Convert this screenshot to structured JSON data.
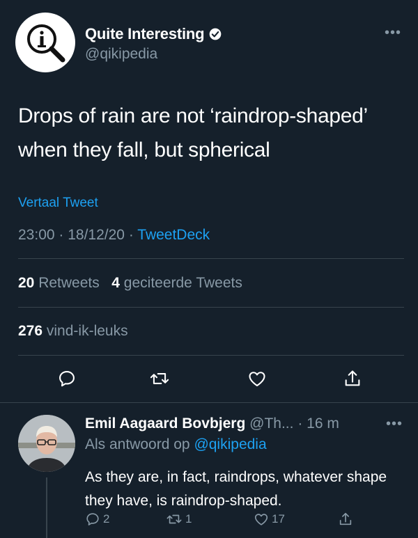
{
  "author": {
    "display_name": "Quite Interesting",
    "handle": "@qikipedia",
    "verified": true,
    "more_icon": "more-horizontal-icon"
  },
  "tweet": {
    "text": "Drops of rain are not ‘raindrop-shaped’ when they fall, but spherical",
    "translate_label": "Vertaal Tweet",
    "time": "23:00",
    "date": "18/12/20",
    "source": "TweetDeck"
  },
  "stats": {
    "retweets_count": "20",
    "retweets_label": "Retweets",
    "quotes_count": "4",
    "quotes_label": "geciteerde Tweets",
    "likes_count": "276",
    "likes_label": "vind-ik-leuks"
  },
  "actions": [
    "reply-icon",
    "retweet-icon",
    "like-icon",
    "share-icon"
  ],
  "reply": {
    "name": "Emil Aagaard Bovbjerg",
    "handle": "@Th...",
    "time": "· 16 m",
    "replying_prefix": "Als antwoord op",
    "replying_to": "@qikipedia",
    "text": "As they are, in fact, raindrops, whatever shape they have, is raindrop-shaped.",
    "reply_count": "2",
    "retweet_count": "1",
    "like_count": "17"
  },
  "colors": {
    "background": "#15202b",
    "accent": "#1da1f2",
    "muted": "#8899a6",
    "divider": "#38444d"
  }
}
